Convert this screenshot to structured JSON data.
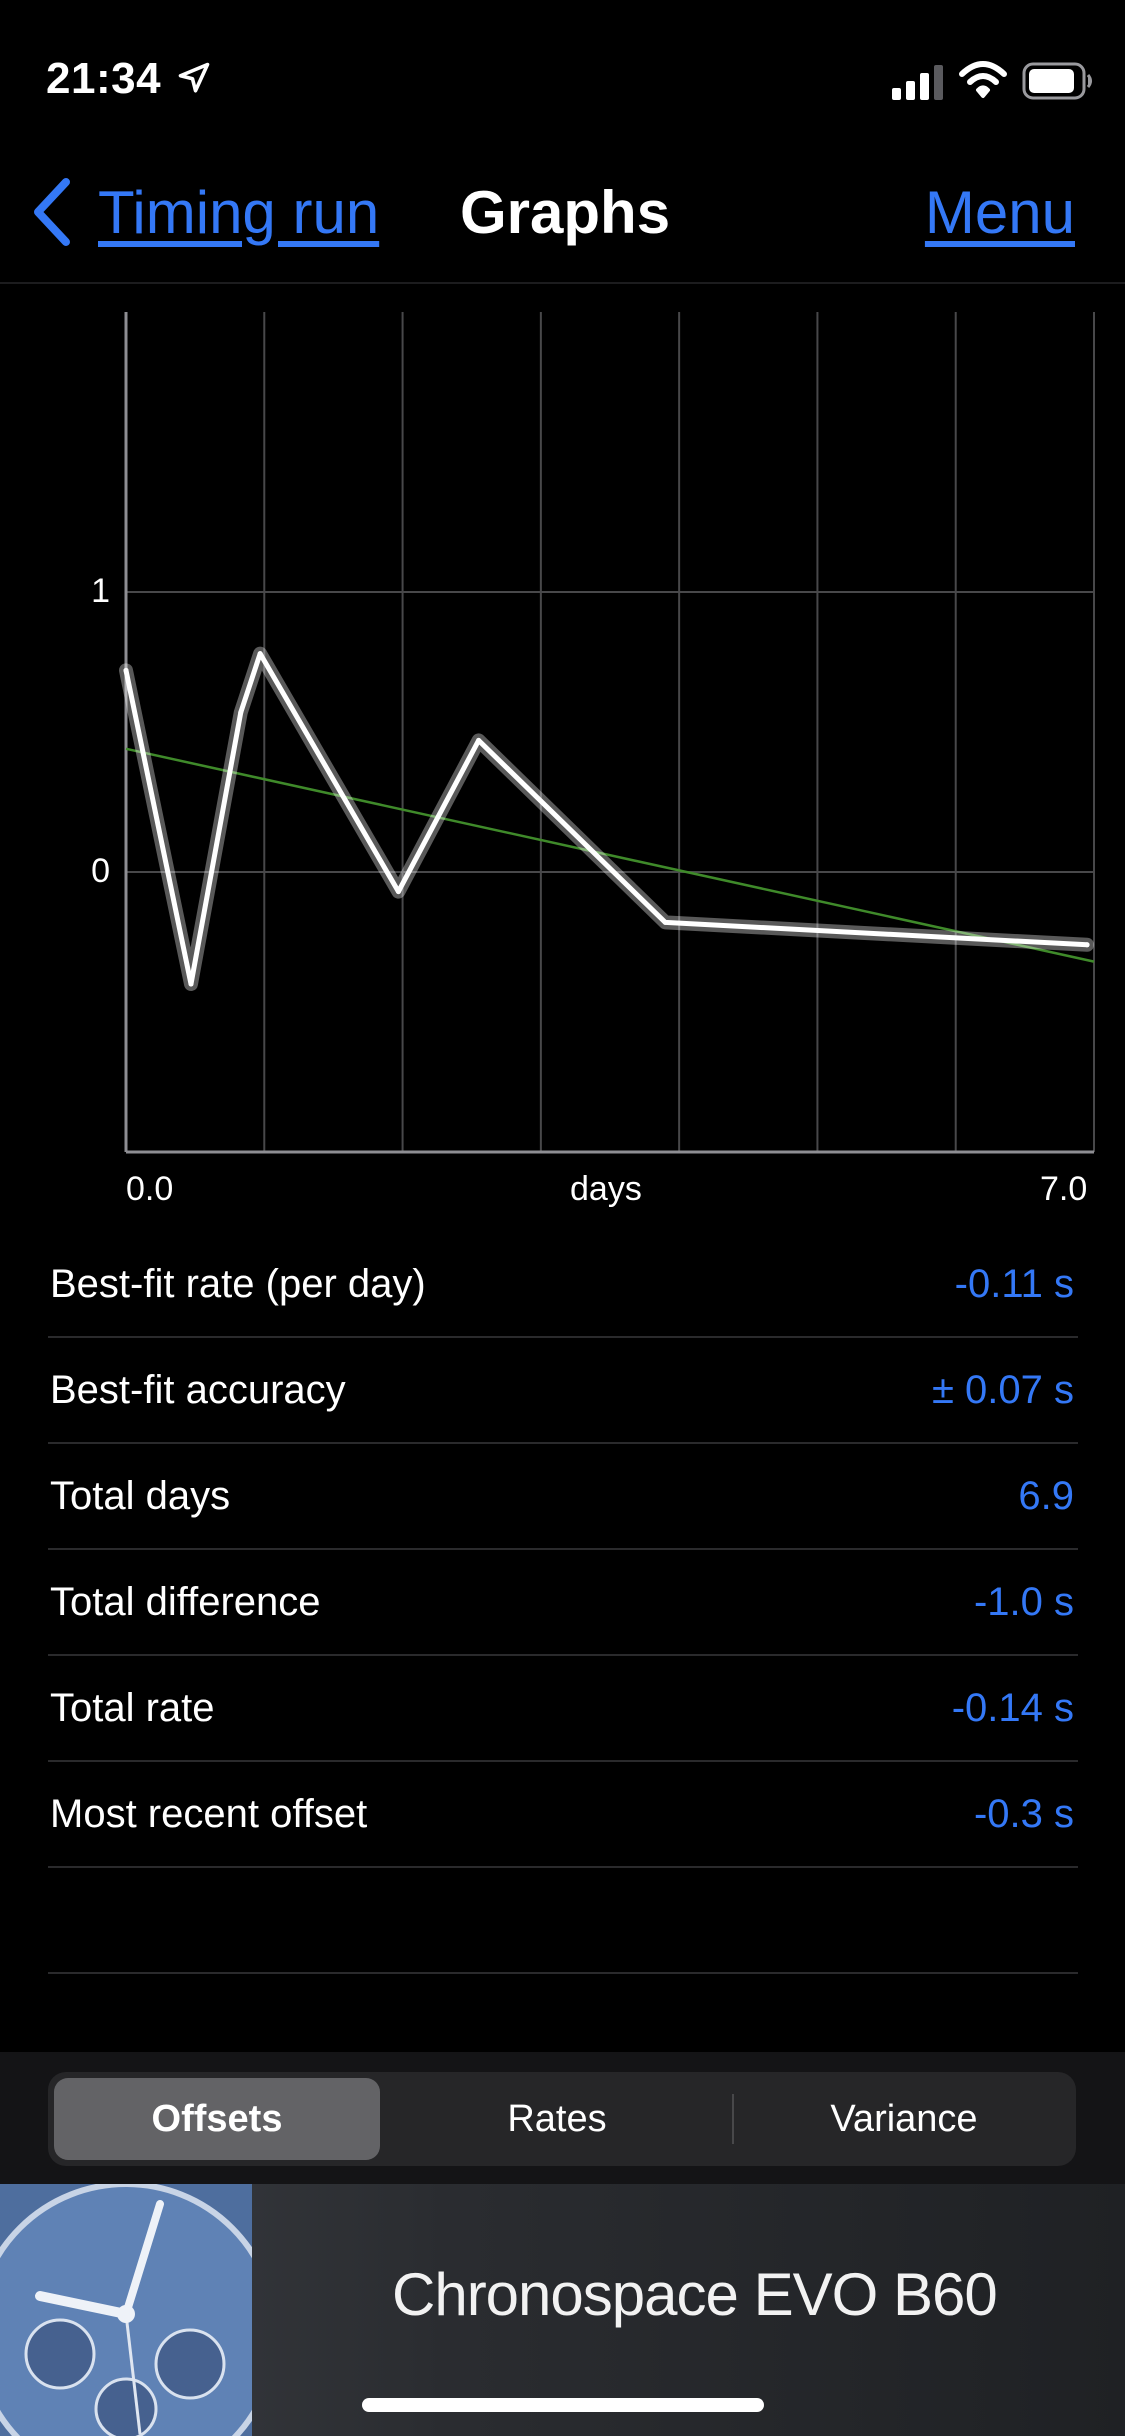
{
  "status": {
    "time": "21:34"
  },
  "nav": {
    "back_label": "Timing run",
    "title": "Graphs",
    "menu_label": "Menu"
  },
  "chart_data": {
    "type": "line",
    "xlabel": "days",
    "x_tick_labels": [
      "0.0",
      "7.0"
    ],
    "y_tick_labels": [
      "1",
      "0"
    ],
    "xlim": [
      0,
      7
    ],
    "ylim": [
      -1,
      2
    ],
    "grid": true,
    "series": [
      {
        "x": [
          0.0,
          0.47,
          0.83,
          0.97,
          1.97,
          2.55,
          3.9,
          6.95
        ],
        "y": [
          0.72,
          -0.4,
          0.57,
          0.78,
          -0.07,
          0.47,
          -0.18,
          -0.26
        ],
        "color": "#ffffff"
      },
      {
        "x": [
          0.0,
          7.0
        ],
        "y": [
          0.44,
          -0.32
        ],
        "color": "#3f8a2a"
      }
    ]
  },
  "stats": [
    {
      "label": "Best-fit rate (per day)",
      "value": "-0.11 s"
    },
    {
      "label": "Best-fit accuracy",
      "value": "± 0.07 s"
    },
    {
      "label": "Total days",
      "value": "6.9"
    },
    {
      "label": "Total difference",
      "value": "-1.0 s"
    },
    {
      "label": "Total rate",
      "value": "-0.14 s"
    },
    {
      "label": "Most recent offset",
      "value": "-0.3 s"
    }
  ],
  "tabs": {
    "items": [
      "Offsets",
      "Rates",
      "Variance"
    ],
    "selected": "Offsets"
  },
  "banner": {
    "watch_name": "Chronospace EVO B60"
  },
  "colors": {
    "accent": "#3478f6",
    "trend": "#3f8a2a",
    "grid": "#48484a"
  },
  "icons": [
    "location-arrow-icon",
    "cellular-signal-icon",
    "wifi-icon",
    "battery-icon",
    "chevron-left-icon",
    "watch-thumbnail"
  ]
}
